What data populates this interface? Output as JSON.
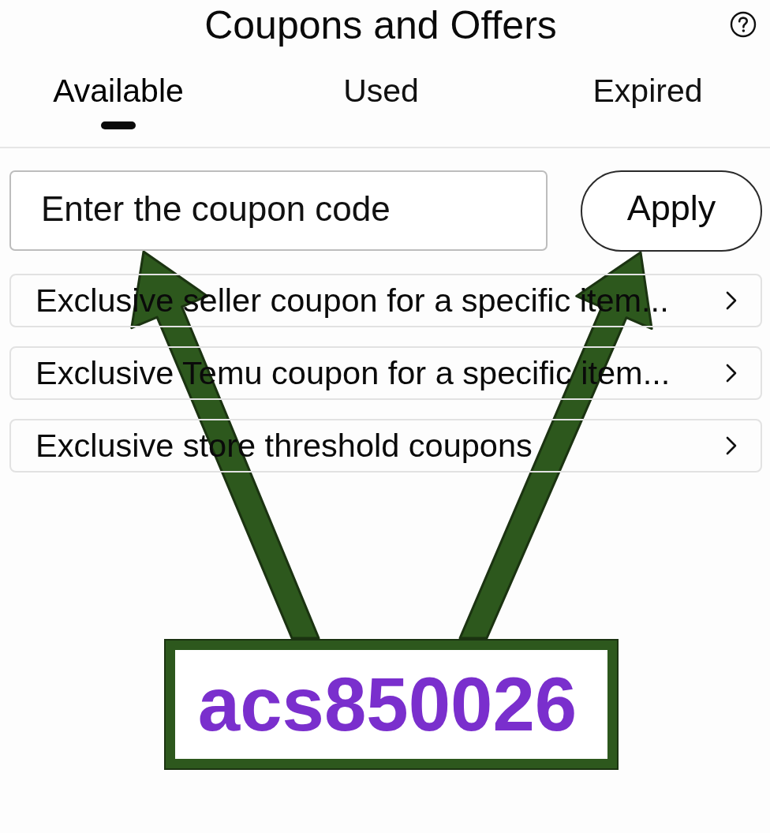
{
  "header": {
    "title": "Coupons and Offers"
  },
  "tabs": [
    {
      "label": "Available",
      "selected": true
    },
    {
      "label": "Used",
      "selected": false
    },
    {
      "label": "Expired",
      "selected": false
    }
  ],
  "coupon_entry": {
    "placeholder": "Enter the coupon code",
    "button": "Apply"
  },
  "coupon_categories": [
    {
      "label": "Exclusive seller coupon for a specific item..."
    },
    {
      "label": "Exclusive Temu coupon for a specific item..."
    },
    {
      "label": "Exclusive store threshold coupons"
    }
  ],
  "annotation": {
    "code": "acs850026"
  }
}
